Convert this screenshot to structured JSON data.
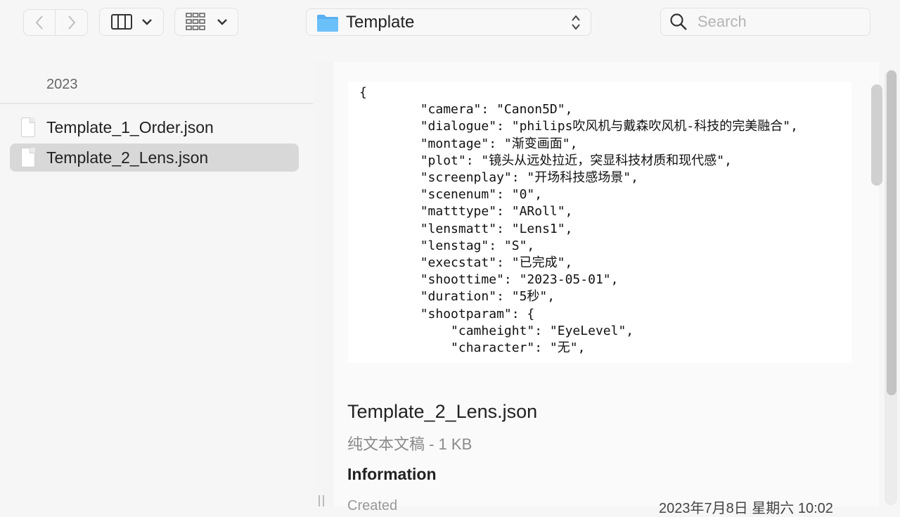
{
  "toolbar": {
    "path_label": "Template",
    "search_placeholder": "Search",
    "icons": {
      "back": "chevron-left-icon",
      "forward": "chevron-right-icon",
      "view": "column-view-icon",
      "group": "grid-icon",
      "folder": "folder-icon",
      "search": "magnifier-icon"
    }
  },
  "sidebar": {
    "section_title": "2023",
    "files": [
      {
        "name": "Template_1_Order.json",
        "selected": false
      },
      {
        "name": "Template_2_Lens.json",
        "selected": true
      }
    ]
  },
  "preview": {
    "code": "{\n        \"camera\": \"Canon5D\",\n        \"dialogue\": \"philips吹风机与戴森吹风机-科技的完美融合\",\n        \"montage\": \"渐变画面\",\n        \"plot\": \"镜头从远处拉近，突显科技材质和现代感\",\n        \"screenplay\": \"开场科技感场景\",\n        \"scenenum\": \"0\",\n        \"matttype\": \"ARoll\",\n        \"lensmatt\": \"Lens1\",\n        \"lenstag\": \"S\",\n        \"execstat\": \"已完成\",\n        \"shoottime\": \"2023-05-01\",\n        \"duration\": \"5秒\",\n        \"shootparam\": {\n            \"camheight\": \"EyeLevel\",\n            \"character\": \"无\",",
    "file_name": "Template_2_Lens.json",
    "kind": "纯文本文稿 - 1 KB",
    "info_title": "Information",
    "created_label": "Created",
    "created_value": "2023年7月8日 星期六 10:02"
  },
  "colors": {
    "folder": "#5ab0f0",
    "selection": "#d8d8d8",
    "background": "#f6f6f6"
  }
}
